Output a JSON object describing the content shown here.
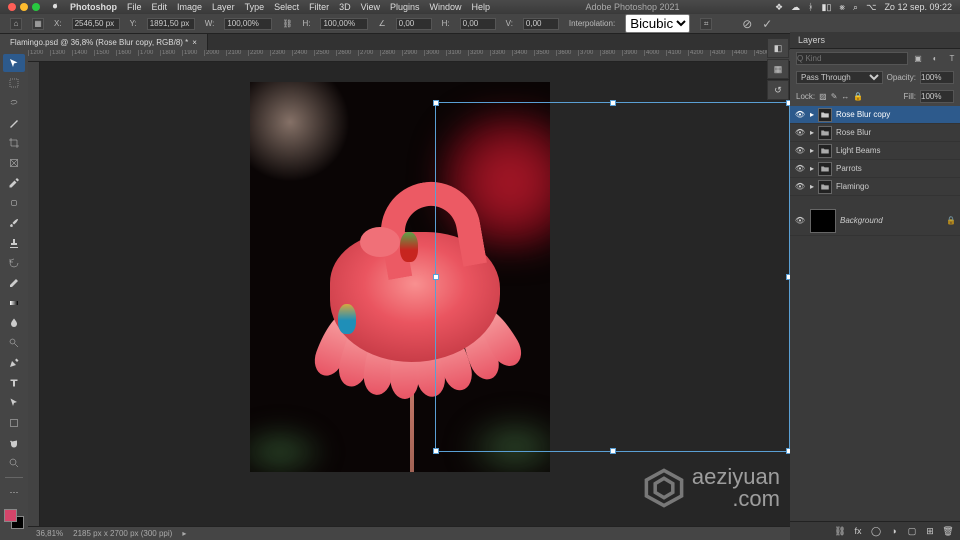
{
  "mac": {
    "app": "Photoshop",
    "menus": [
      "File",
      "Edit",
      "Image",
      "Layer",
      "Type",
      "Select",
      "Filter",
      "3D",
      "View",
      "Plugins",
      "Window",
      "Help"
    ],
    "title": "Adobe Photoshop 2021",
    "clock": "Zo 12 sep.  09:22"
  },
  "options": {
    "x_label": "X:",
    "x": "2546,50 px",
    "y_label": "Y:",
    "y": "1891,50 px",
    "w_label": "W:",
    "w": "100,00%",
    "h_label": "H:",
    "h": "100,00%",
    "angle_label": "∠",
    "angle": "0,00",
    "skew_h_label": "H:",
    "skew_h": "0,00",
    "skew_v_label": "V:",
    "skew_v": "0,00",
    "interp_label": "Interpolation:",
    "interp": "Bicubic"
  },
  "tab": {
    "title": "Flamingo.psd @ 36,8% (Rose Blur copy, RGB/8) *"
  },
  "ruler": [
    "1200",
    "1300",
    "1400",
    "1500",
    "1600",
    "1700",
    "1800",
    "1900",
    "2000",
    "2100",
    "2200",
    "2300",
    "2400",
    "2500",
    "2600",
    "2700",
    "2800",
    "2900",
    "3000",
    "3100",
    "3200",
    "3300",
    "3400",
    "3500",
    "3600",
    "3700",
    "3800",
    "3900",
    "4000",
    "4100",
    "4200",
    "4300",
    "4400",
    "4500"
  ],
  "layers_panel": {
    "title": "Layers",
    "search_ph": "Q Kind",
    "blend": "Pass Through",
    "opacity_label": "Opacity:",
    "opacity": "100%",
    "lock_label": "Lock:",
    "fill_label": "Fill:",
    "fill": "100%",
    "items": [
      {
        "name": "Rose Blur copy",
        "type": "folder",
        "sel": true,
        "vis": true
      },
      {
        "name": "Rose Blur",
        "type": "folder",
        "sel": false,
        "vis": true
      },
      {
        "name": "Light Beams",
        "type": "folder",
        "sel": false,
        "vis": true
      },
      {
        "name": "Parrots",
        "type": "folder",
        "sel": false,
        "vis": true
      },
      {
        "name": "Flamingo",
        "type": "folder",
        "sel": false,
        "vis": true
      }
    ],
    "bg_layer": "Background"
  },
  "status": {
    "zoom": "36,81%",
    "doc": "2185 px x 2700 px (300 ppi)"
  },
  "watermark": {
    "line1": "aeziyuan",
    "line2": ".com"
  }
}
